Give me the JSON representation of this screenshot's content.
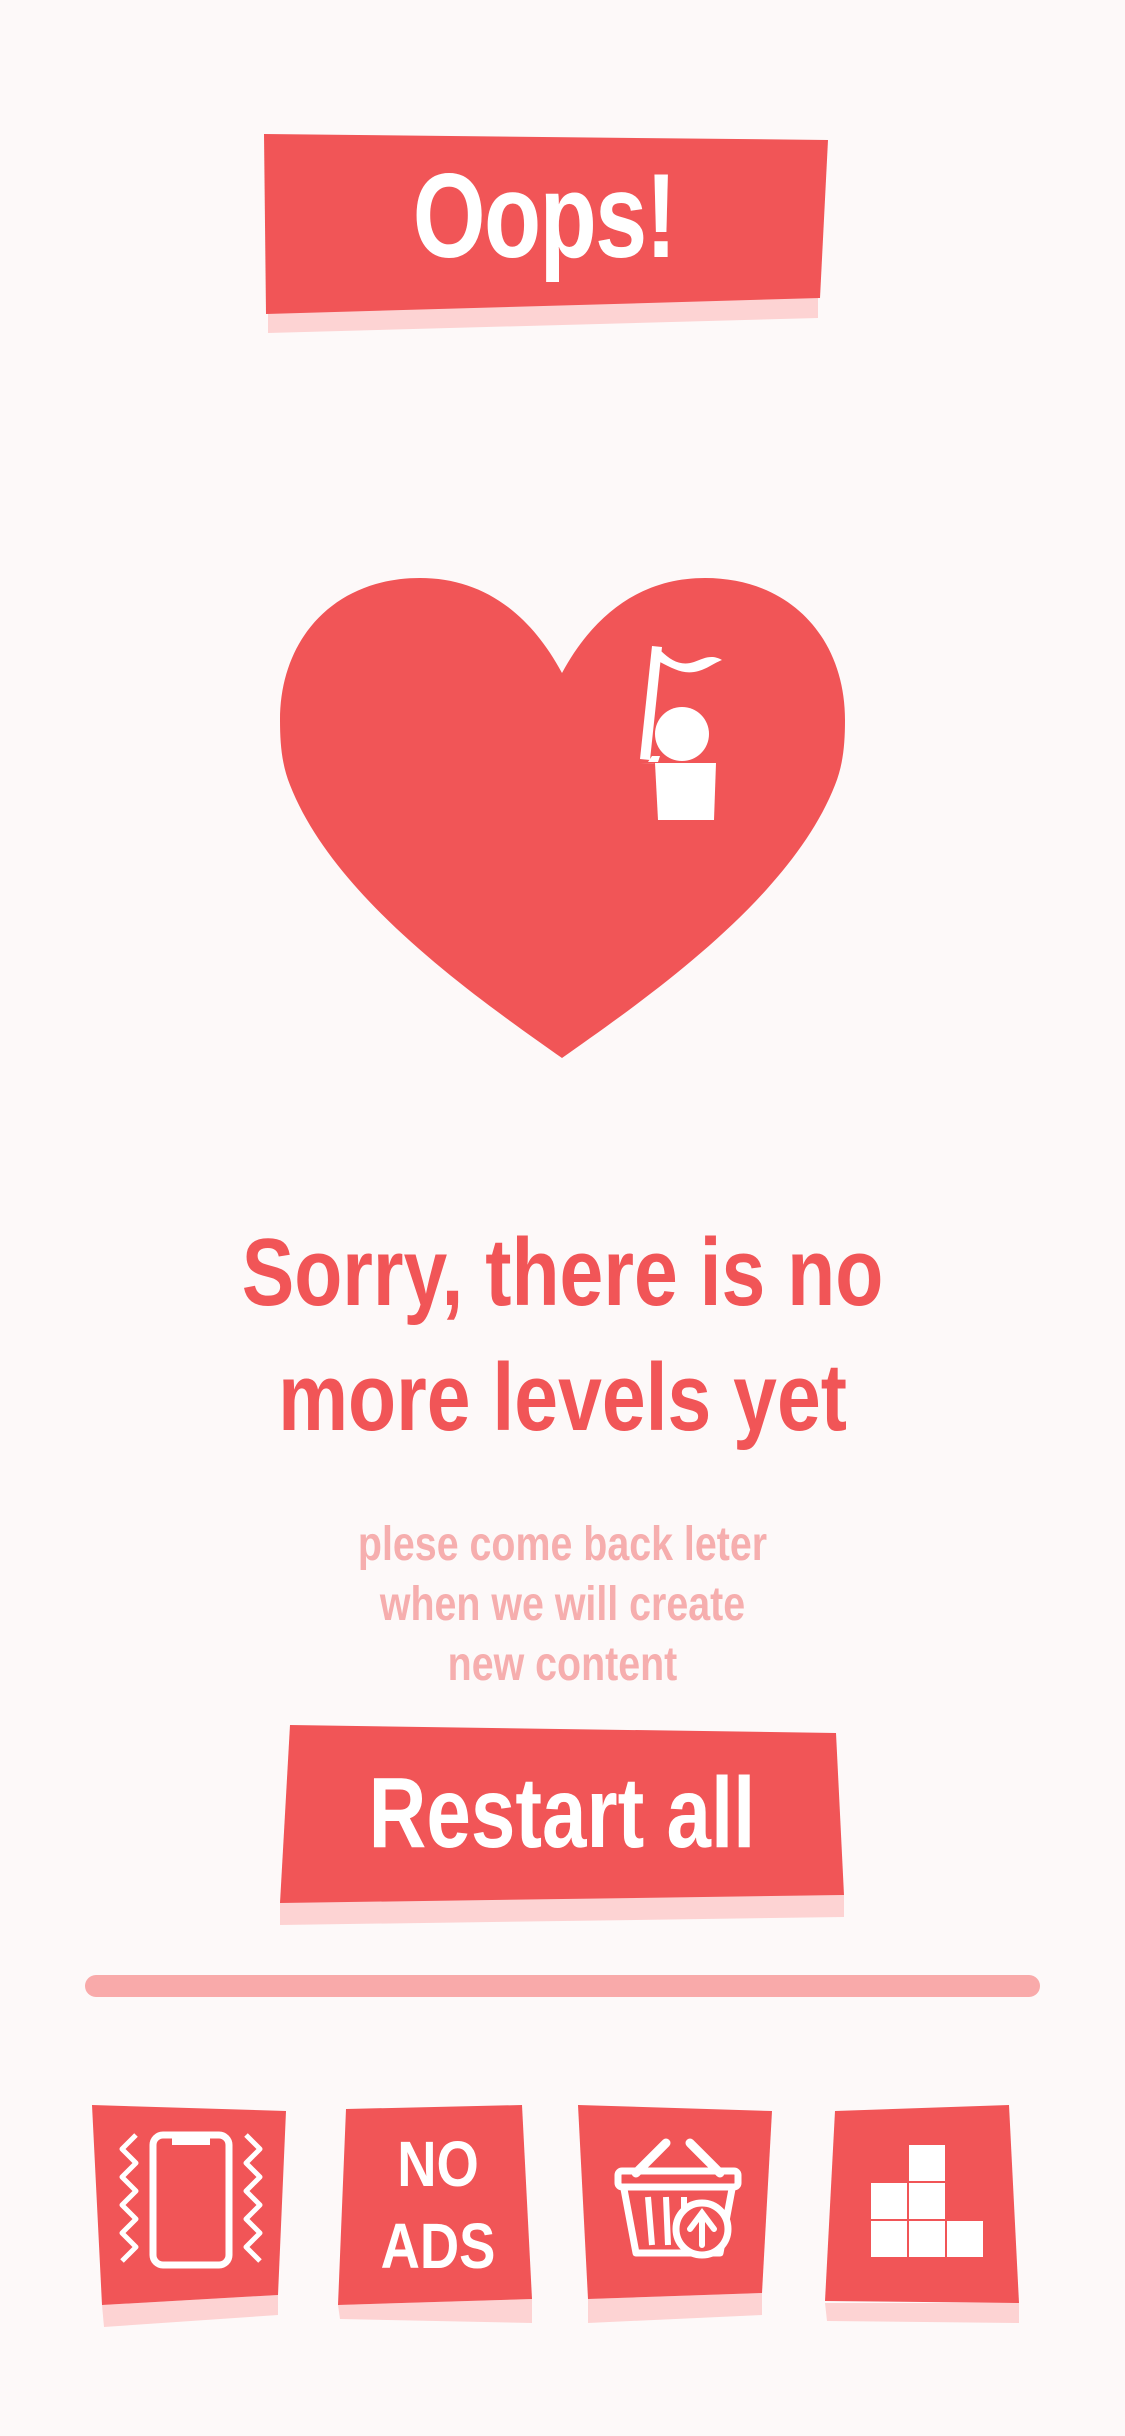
{
  "title": "Oops!",
  "headline": {
    "line1": "Sorry, there is no",
    "line2": "more levels yet"
  },
  "subtext": {
    "line1": "plese come back leter",
    "line2": "when we will create",
    "line3": "new content"
  },
  "restart_button": {
    "label": "Restart all"
  },
  "bottom_bar": {
    "vibration_icon": "phone-vibrate-icon",
    "no_ads": {
      "line1": "NO",
      "line2": "ADS"
    },
    "shop_icon": "shopping-basket-icon",
    "levels_icon": "blocks-stack-icon"
  },
  "colors": {
    "accent": "#f15557",
    "shadow": "#fdd3d3",
    "subtext": "#f6aeae",
    "divider": "#f9aaaa",
    "background": "#fdf9f9"
  }
}
